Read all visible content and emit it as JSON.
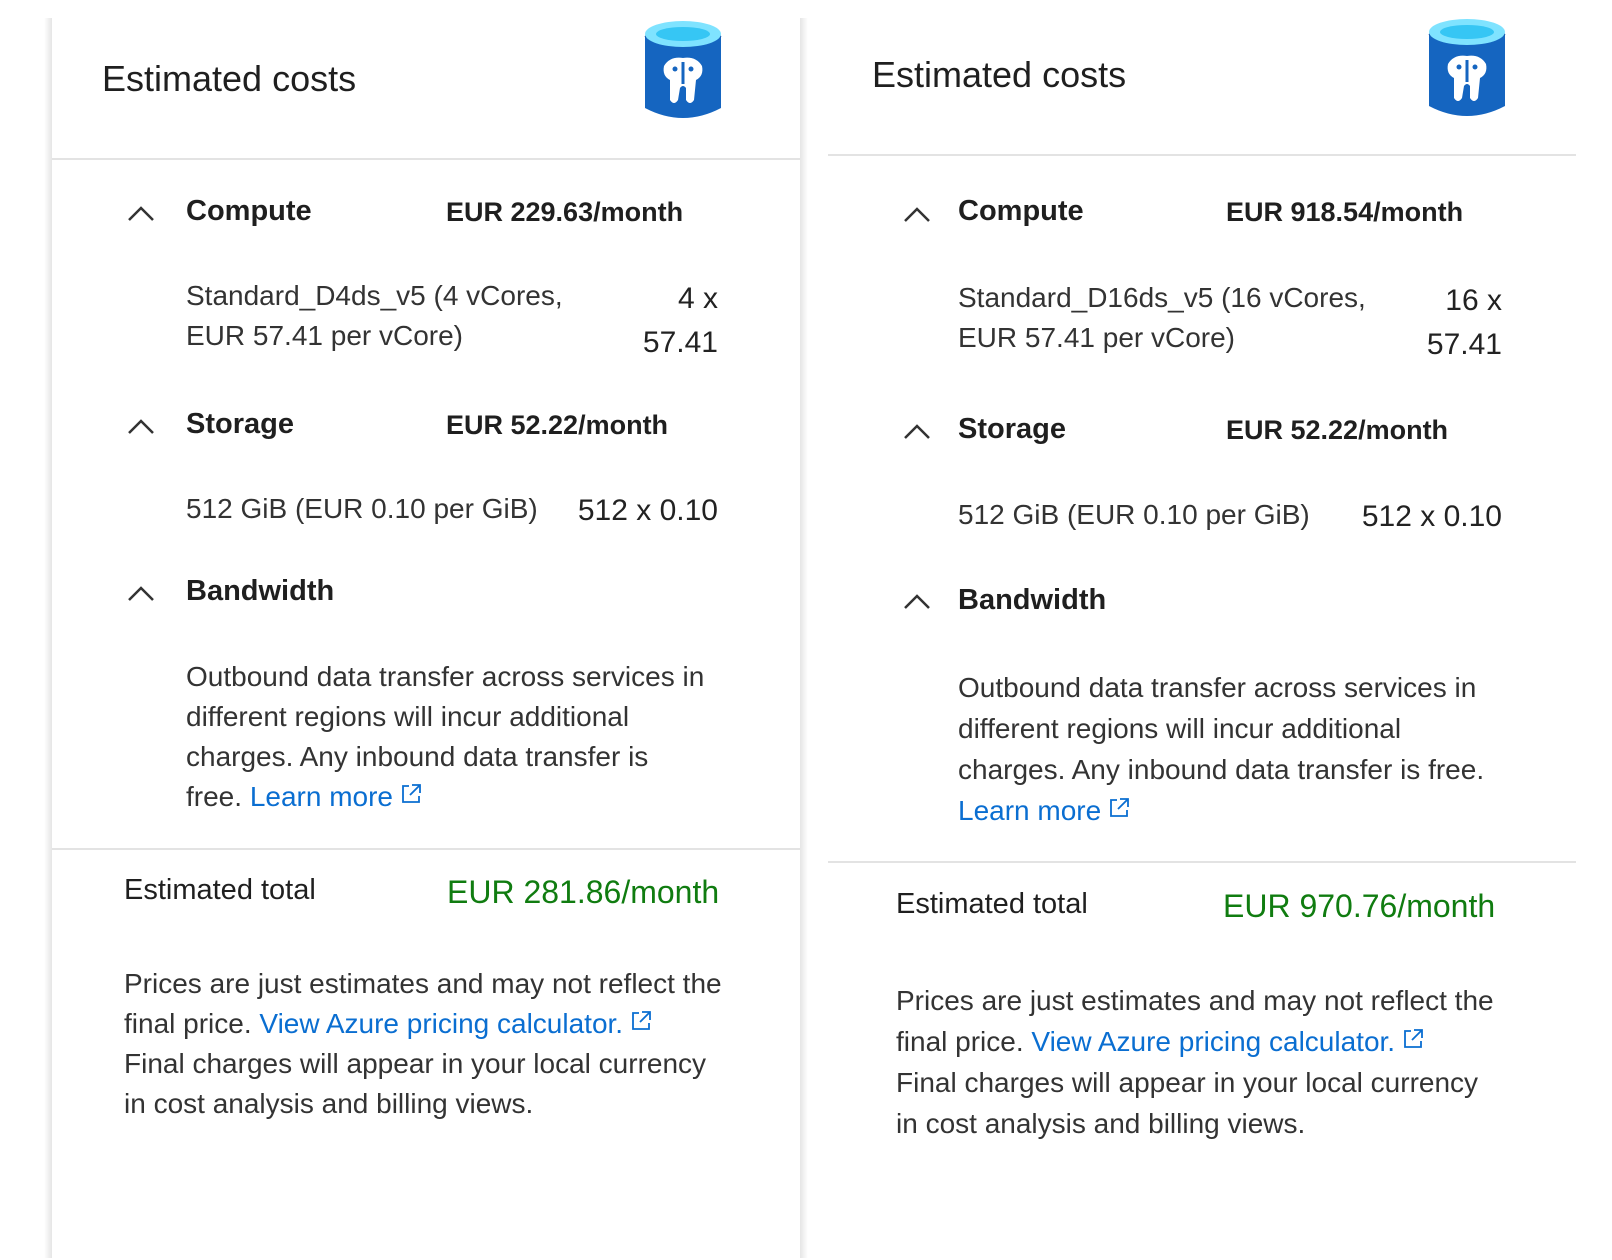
{
  "panels": [
    {
      "title": "Estimated costs",
      "compute": {
        "label": "Compute",
        "cost": "EUR 229.63/month",
        "detail": "Standard_D4ds_v5 (4 vCores, EUR 57.41 per vCore)",
        "qty_line1": "4 x",
        "qty_line2": "57.41"
      },
      "storage": {
        "label": "Storage",
        "cost": "EUR 52.22/month",
        "detail": "512 GiB (EUR 0.10 per GiB)",
        "qty": "512 x 0.10"
      },
      "bandwidth": {
        "label": "Bandwidth",
        "text": "Outbound data transfer across services in different regions will incur additional charges. Any inbound data transfer is free.",
        "link": "Learn more"
      },
      "total": {
        "label": "Estimated total",
        "value": "EUR 281.86/month"
      },
      "footnote": {
        "text1": "Prices are just estimates and may not reflect the final price.",
        "link": "View Azure pricing calculator.",
        "text2": "Final charges will appear in your local currency in cost analysis and billing views."
      }
    },
    {
      "title": "Estimated costs",
      "compute": {
        "label": "Compute",
        "cost": "EUR 918.54/month",
        "detail": "Standard_D16ds_v5 (16 vCores, EUR 57.41 per vCore)",
        "qty_line1": "16 x",
        "qty_line2": "57.41"
      },
      "storage": {
        "label": "Storage",
        "cost": "EUR 52.22/month",
        "detail": "512 GiB (EUR 0.10 per GiB)",
        "qty": "512 x 0.10"
      },
      "bandwidth": {
        "label": "Bandwidth",
        "text": "Outbound data transfer across services in different regions will incur additional charges. Any inbound data transfer is free.",
        "link": "Learn more"
      },
      "total": {
        "label": "Estimated total",
        "value": "EUR 970.76/month"
      },
      "footnote": {
        "text1": "Prices are just estimates and may not reflect the final price.",
        "link": "View Azure pricing calculator.",
        "text2": "Final charges will appear in your local currency in cost analysis and billing views."
      }
    }
  ],
  "icons": {
    "service": "postgresql-database-icon",
    "expand": "chevron-up-icon",
    "external": "external-link-icon"
  },
  "colors": {
    "link": "#0a6ed1",
    "total": "#107c10",
    "icon_blue": "#1565c0",
    "icon_cyan": "#50e6ff"
  }
}
